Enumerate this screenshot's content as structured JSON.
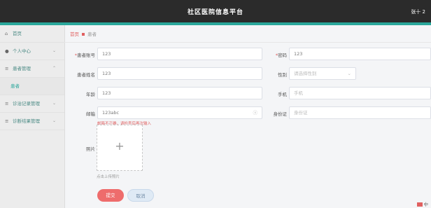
{
  "header": {
    "title": "社区医院信息平台",
    "user": "张十 2"
  },
  "sidebar": {
    "items": [
      {
        "label": "首页",
        "icon": "home-icon"
      },
      {
        "label": "个人中心",
        "icon": "user-icon"
      },
      {
        "label": "患者管理",
        "icon": "list-icon"
      },
      {
        "sub_label": "患者"
      },
      {
        "label": "诊治记录管理",
        "icon": "list-icon"
      },
      {
        "label": "诊断结果管理",
        "icon": "list-icon"
      }
    ]
  },
  "breadcrumb": {
    "home": "首页",
    "current": "患者"
  },
  "form": {
    "patient_no": {
      "label": "患者账号",
      "value": "123"
    },
    "password": {
      "label": "密码",
      "value": "123"
    },
    "patient_name": {
      "label": "患者姓名",
      "value": "123"
    },
    "gender": {
      "label": "性别",
      "placeholder": "请选择性别"
    },
    "age": {
      "label": "年龄",
      "value": "123"
    },
    "phone": {
      "label": "手机",
      "placeholder": "手机"
    },
    "email": {
      "label": "邮箱",
      "value": "123abc",
      "error": "邮箱不正确，请检查后再次输入"
    },
    "id_card": {
      "label": "身份证",
      "placeholder": "身份证"
    },
    "photo": {
      "label": "照片",
      "tip": "点击上传照片"
    }
  },
  "buttons": {
    "submit": "提交",
    "cancel": "取消"
  },
  "corner": {
    "text": "中"
  }
}
